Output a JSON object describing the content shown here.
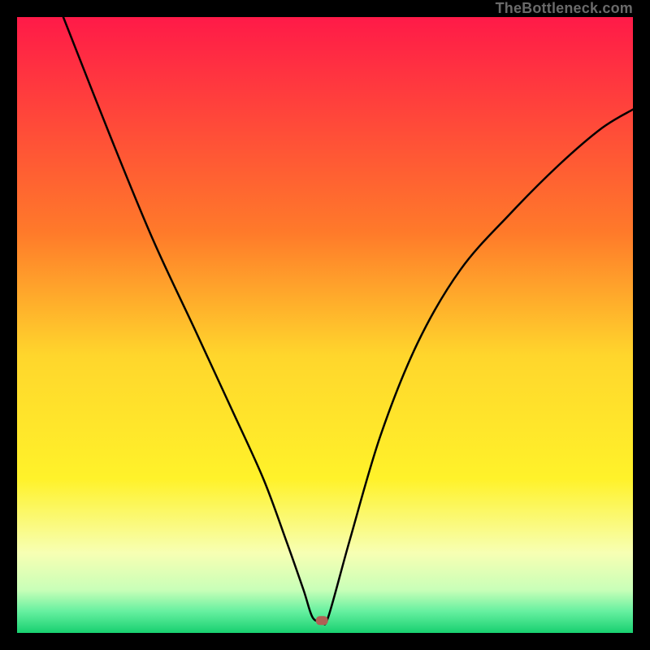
{
  "watermark": "TheBottleneck.com",
  "chart_data": {
    "type": "line",
    "title": "",
    "xlabel": "",
    "ylabel": "",
    "xlim": [
      0,
      100
    ],
    "ylim": [
      0,
      100
    ],
    "grid": false,
    "legend": false,
    "series": [
      {
        "name": "curve",
        "x": [
          7.5,
          15,
          22,
          29,
          35,
          40,
          43.7,
          46.5,
          48,
          49.5,
          50.5,
          54,
          59,
          65,
          72,
          80,
          88,
          95,
          100
        ],
        "values": [
          100,
          81,
          64,
          49,
          36,
          25,
          15,
          7,
          2.5,
          2,
          2.5,
          15,
          32,
          47,
          59,
          68,
          76,
          82,
          85
        ]
      }
    ],
    "marker": {
      "x": 49.5,
      "y": 2,
      "color": "#b06055"
    },
    "background_gradient": {
      "stops": [
        {
          "offset": 0.0,
          "color": "#ff1a48"
        },
        {
          "offset": 0.35,
          "color": "#ff7a2a"
        },
        {
          "offset": 0.55,
          "color": "#ffd62c"
        },
        {
          "offset": 0.75,
          "color": "#fff22a"
        },
        {
          "offset": 0.87,
          "color": "#f7ffb3"
        },
        {
          "offset": 0.93,
          "color": "#c9ffb8"
        },
        {
          "offset": 0.965,
          "color": "#66f0a0"
        },
        {
          "offset": 1.0,
          "color": "#18d070"
        }
      ]
    }
  }
}
